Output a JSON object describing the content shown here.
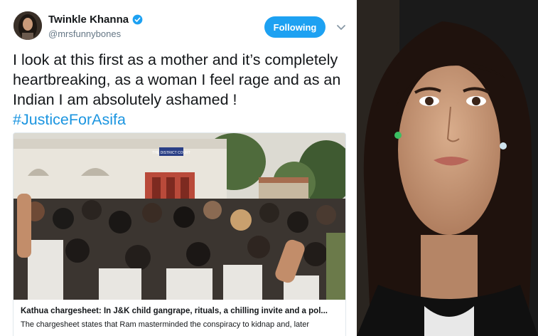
{
  "tweet": {
    "display_name": "Twinkle Khanna",
    "handle": "@mrsfunnybones",
    "follow_label": "Following",
    "text": "I look at this first as a mother and it’s completely heartbreaking, as a woman I feel rage and as an Indian I am absolutely ashamed ! ",
    "hashtag": "#JusticeForAsifa",
    "accent_color": "#1da1f2",
    "hashtag_color": "#1b95e0"
  },
  "card": {
    "sign_text": "THE DISTRICT COURT",
    "title": "Kathua chargesheet: In J&K child gangrape, rituals, a chilling invite and a pol...",
    "description": "The chargesheet states that Ram masterminded the conspiracy to kidnap and, later"
  },
  "icons": {
    "verified": "verified-badge-icon",
    "caret": "chevron-down-icon"
  }
}
